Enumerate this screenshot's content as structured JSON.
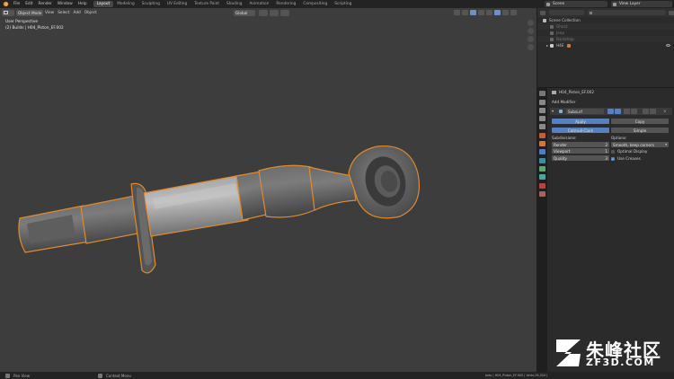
{
  "topbar": {
    "menus": [
      "File",
      "Edit",
      "Render",
      "Window",
      "Help"
    ],
    "workspaces": [
      "Layout",
      "Modeling",
      "Sculpting",
      "UV Editing",
      "Texture Paint",
      "Shading",
      "Animation",
      "Rendering",
      "Compositing",
      "Scripting"
    ],
    "active_workspace": "Layout",
    "scene_label": "Scene",
    "view_layer_label": "View Layer"
  },
  "viewport": {
    "mode": "Object Mode",
    "menus": [
      "View",
      "Select",
      "Add",
      "Object"
    ],
    "transform_orientation": "Global",
    "info_line1": "User Perspective",
    "info_line2": "(2) Builds | H04_Piston_EF.002"
  },
  "outliner": {
    "root": "Scene Collection",
    "rows": [
      {
        "label": "Ghost",
        "dim": true
      },
      {
        "label": "Jeep",
        "dim": true
      },
      {
        "label": "Backdrop",
        "dim": true
      },
      {
        "label": "H4E",
        "dim": false
      }
    ]
  },
  "properties": {
    "object_name": "H04_Piston_EF.002",
    "add_modifier_label": "Add Modifier",
    "modifier_name": "Subsurf",
    "apply_label": "Apply",
    "copy_label": "Copy",
    "catmull_label": "Catmull-Clark",
    "simple_label": "Simple",
    "subdivisions_label": "Subdivisions:",
    "options_label": "Options:",
    "render_label": "Render",
    "render_value": "2",
    "viewport_label": "Viewport",
    "viewport_value": "1",
    "quality_label": "Quality",
    "quality_value": "3",
    "uv_smooth_value": "Smooth, keep corners",
    "optimal_display_label": "Optimal Display",
    "use_creases_label": "Use Creases",
    "optimal_display_checked": false,
    "use_creases_checked": true
  },
  "statusbar": {
    "left": "Pan View",
    "middle": "Context Menu",
    "right": "Jeep | H04_Piston_EF.002 | Verts:26,324 | Faces:36,544 | Tris:21,528 | Objects:1/3 | Mem: 113.4 MiB | v2.80"
  },
  "watermark": {
    "title": "朱峰社区",
    "subtitle": "ZF3D.COM"
  },
  "colors": {
    "accent": "#5680c2",
    "selection_outline": "#e08a2c",
    "viewport_bg": "#3d3d3d"
  }
}
